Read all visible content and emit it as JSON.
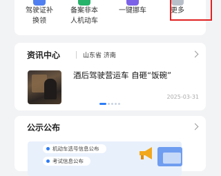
{
  "services": [
    {
      "label": "驾驶证补\n换领",
      "icon": "license-icon",
      "color": "#4f7ff0"
    },
    {
      "label": "备案非本\n人机动车",
      "icon": "car-record-icon",
      "color": "#27b36a"
    },
    {
      "label": "一键挪车",
      "icon": "move-car-icon",
      "color": "#7b61e8"
    },
    {
      "label": "更多",
      "icon": "grid-icon",
      "color": "#b9bfc9"
    }
  ],
  "news": {
    "title": "资讯中心",
    "location": "山东省 济南",
    "headline": "酒后驾驶营运车 自砸“饭碗”",
    "date": "2025-03-31"
  },
  "notice": {
    "title": "公示公布",
    "items": [
      "机动车选号信息公布",
      "考试信息公布"
    ]
  },
  "colors": {
    "accent": "#2d7cf6",
    "highlight": "#e02020"
  }
}
